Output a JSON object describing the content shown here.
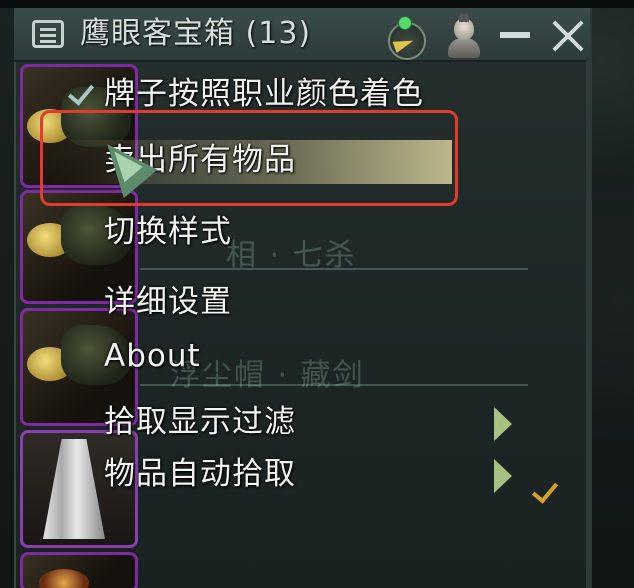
{
  "window": {
    "title": "鹰眼客宝箱 (13)"
  },
  "background_items": {
    "name_row2": "相 · 七杀",
    "name_row3": "浮尘帽 · 藏剑"
  },
  "menu": {
    "items": [
      {
        "label": "牌子按照职业颜色着色",
        "checked": true
      },
      {
        "label": "卖出所有物品",
        "highlighted": true
      },
      {
        "label": "切换样式"
      },
      {
        "label": "详细设置"
      },
      {
        "label": "About"
      },
      {
        "label": "拾取显示过滤",
        "has_submenu": true
      },
      {
        "label": "物品自动拾取",
        "has_submenu": true,
        "checked": true
      }
    ]
  },
  "colors": {
    "annotation_box": "#e23a2c",
    "slot_border_purple": "#7f2aa2",
    "checkmark": "#a8c8c0",
    "checkmark_gold": "#d4a22a",
    "submenu_arrow": "#a6c283"
  }
}
